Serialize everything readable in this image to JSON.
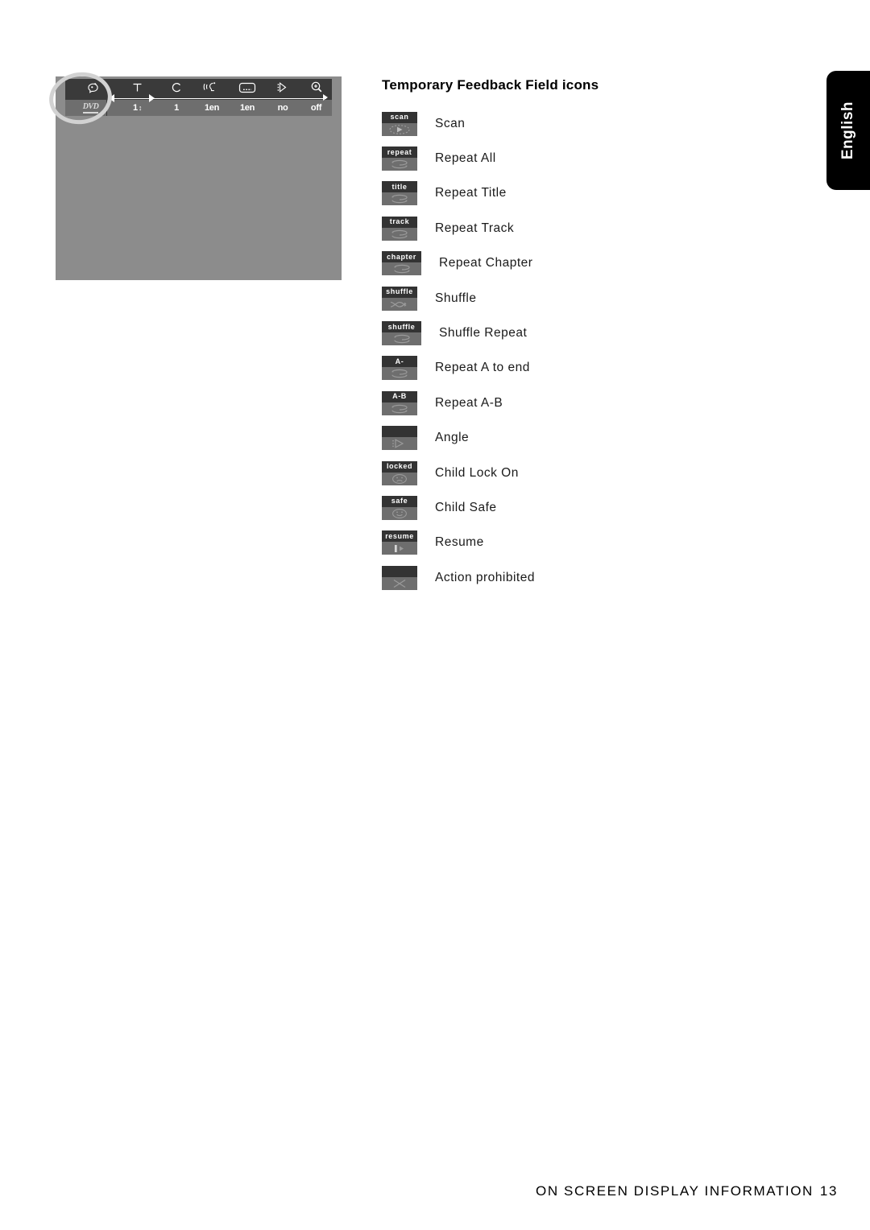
{
  "tv_figure": {
    "name": "dvd-osd-status-bar",
    "disc_label": "DVD",
    "columns": [
      {
        "icon": "head-audio-icon",
        "value": ""
      },
      {
        "icon": "title-T-icon",
        "value": "1"
      },
      {
        "icon": "chapter-C-icon",
        "value": "1"
      },
      {
        "icon": "audio-language-icon",
        "value": "1en"
      },
      {
        "icon": "subtitle-icon",
        "value": "1en"
      },
      {
        "icon": "angle-icon",
        "value": "no"
      },
      {
        "icon": "zoom-icon",
        "value": "off"
      }
    ]
  },
  "feedback": {
    "title": "Temporary Feedback Field icons",
    "items": [
      {
        "badge_text": "scan",
        "glyph": "scan-play-icon",
        "label": "Scan"
      },
      {
        "badge_text": "repeat",
        "glyph": "repeat-loop-icon",
        "label": "Repeat All"
      },
      {
        "badge_text": "title",
        "glyph": "repeat-loop-icon",
        "label": "Repeat Title"
      },
      {
        "badge_text": "track",
        "glyph": "repeat-loop-icon",
        "label": "Repeat Track"
      },
      {
        "badge_text": "chapter",
        "glyph": "repeat-loop-icon",
        "label": "Repeat Chapter"
      },
      {
        "badge_text": "shuffle",
        "glyph": "shuffle-cross-icon",
        "label": "Shuffle"
      },
      {
        "badge_text": "shuffle",
        "glyph": "repeat-loop-icon",
        "label": "Shuffle Repeat"
      },
      {
        "badge_text": "A-",
        "glyph": "repeat-loop-icon",
        "label": "Repeat A to end"
      },
      {
        "badge_text": "A-B",
        "glyph": "repeat-loop-icon",
        "label": "Repeat A-B"
      },
      {
        "badge_text": "",
        "glyph": "angle-triangle-icon",
        "label": "Angle"
      },
      {
        "badge_text": "locked",
        "glyph": "sad-face-icon",
        "label": "Child Lock On"
      },
      {
        "badge_text": "safe",
        "glyph": "smiley-face-icon",
        "label": "Child Safe"
      },
      {
        "badge_text": "resume",
        "glyph": "resume-play-icon",
        "label": "Resume"
      },
      {
        "badge_text": "",
        "glyph": "cross-prohibited-icon",
        "label": "Action prohibited"
      }
    ]
  },
  "language_tab": {
    "label": "English"
  },
  "footer": {
    "title": "ON SCREEN DISPLAY INFORMATION",
    "page": "13"
  },
  "colors": {
    "screen_gray": "#8c8c8c",
    "bar_dark": "#3a3a3a",
    "bar_mid": "#6e6e6e",
    "badge_top": "#333333",
    "badge_body": "#6e6e6e",
    "highlight_ring": "#d2d2d2",
    "tab_black": "#000000"
  }
}
